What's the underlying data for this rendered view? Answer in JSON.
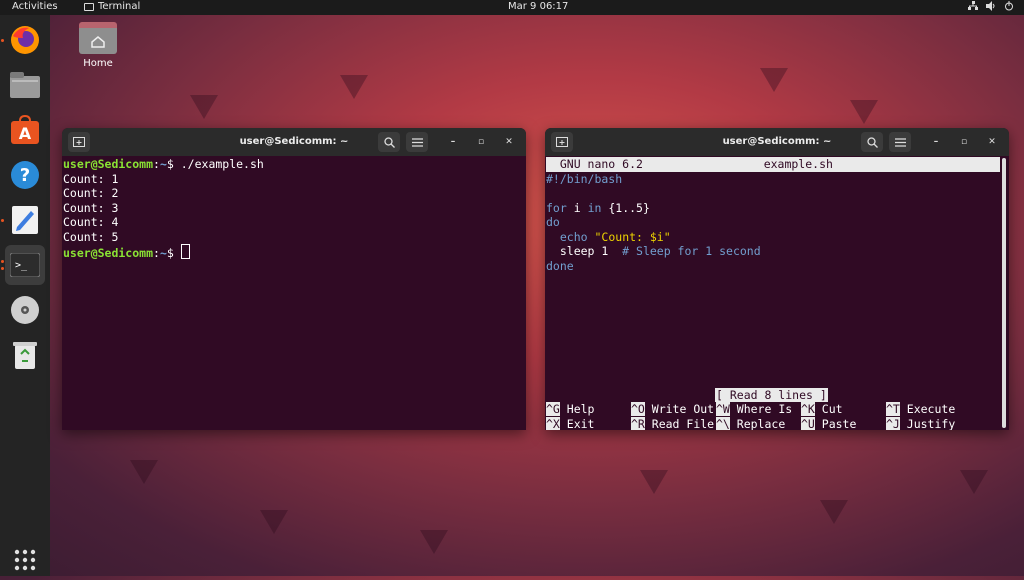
{
  "topbar": {
    "activities": "Activities",
    "app_name": "Terminal",
    "datetime": "Mar 9  06:17"
  },
  "desktop": {
    "home_label": "Home"
  },
  "dock": {
    "items": [
      "firefox-icon",
      "files-icon",
      "software-icon",
      "help-icon",
      "text-editor-icon",
      "terminal-icon",
      "disc-icon",
      "trash-icon"
    ],
    "apps_grid": "show-applications-icon"
  },
  "terminal_left": {
    "title": "user@Sedicomm: ~",
    "prompt_user": "user@Sedicomm",
    "prompt_sep": ":",
    "prompt_path": "~",
    "prompt_end": "$ ",
    "command": "./example.sh",
    "output": [
      "Count: 1",
      "Count: 2",
      "Count: 3",
      "Count: 4",
      "Count: 5"
    ]
  },
  "terminal_right": {
    "title": "user@Sedicomm: ~",
    "nano_version": "  GNU nano 6.2",
    "filename": "example.sh",
    "lines": {
      "shebang": "#!/bin/bash",
      "for_kw": "for",
      "for_var": " i ",
      "in_kw": "in",
      "for_range": " {1..5}",
      "do_kw": "do",
      "echo_kw": "echo",
      "echo_str": "\"Count: $i\"",
      "sleep_cmd": "  sleep 1  ",
      "sleep_cmt": "# Sleep for 1 second",
      "done_kw": "done"
    },
    "status": "[ Read 8 lines ]",
    "shortcuts": [
      [
        {
          "key": "^G",
          "label": " Help"
        },
        {
          "key": "^O",
          "label": " Write Out"
        },
        {
          "key": "^W",
          "label": " Where Is"
        },
        {
          "key": "^K",
          "label": " Cut"
        },
        {
          "key": "^T",
          "label": " Execute"
        }
      ],
      [
        {
          "key": "^X",
          "label": " Exit"
        },
        {
          "key": "^R",
          "label": " Read File"
        },
        {
          "key": "^\\",
          "label": " Replace"
        },
        {
          "key": "^U",
          "label": " Paste"
        },
        {
          "key": "^J",
          "label": " Justify"
        }
      ]
    ]
  },
  "colors": {
    "terminal_bg": "#300a24",
    "accent": "#e95420"
  }
}
